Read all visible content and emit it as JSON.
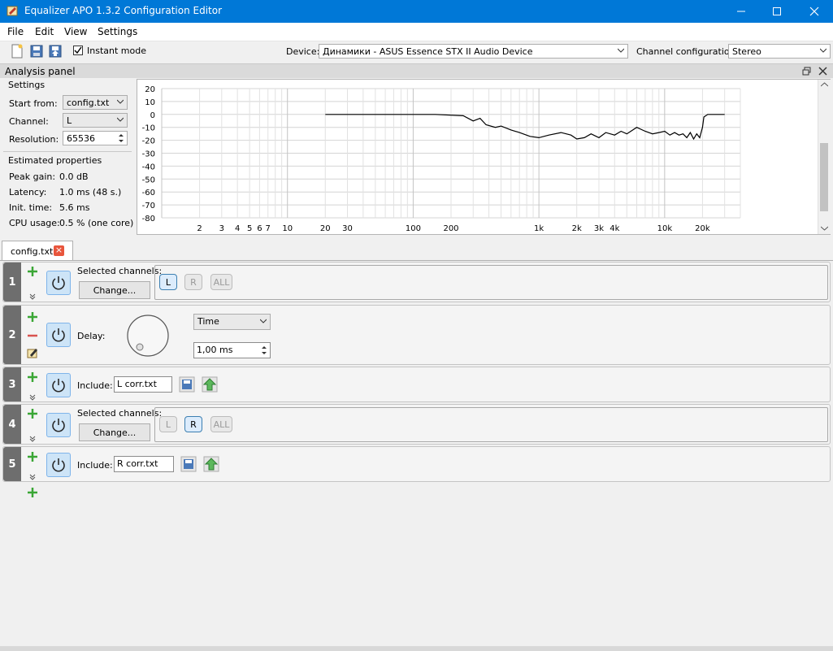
{
  "window": {
    "title": "Equalizer APO 1.3.2 Configuration Editor"
  },
  "menu": [
    "File",
    "Edit",
    "View",
    "Settings"
  ],
  "toolbar": {
    "instant_mode_label": "Instant mode",
    "instant_mode_checked": true,
    "device_label": "Device:",
    "device_value": "Динамики - ASUS Essence STX II Audio Device",
    "channel_config_label": "Channel configuration:",
    "channel_config_value": "Stereo"
  },
  "analysis_panel": {
    "title": "Analysis panel",
    "settings_header": "Settings",
    "start_from_label": "Start from:",
    "start_from_value": "config.txt",
    "channel_label": "Channel:",
    "channel_value": "L",
    "resolution_label": "Resolution:",
    "resolution_value": "65536",
    "estimated_header": "Estimated properties",
    "peak_gain_label": "Peak gain:",
    "peak_gain_value": "0.0 dB",
    "latency_label": "Latency:",
    "latency_value": "1.0 ms (48 s.)",
    "init_time_label": "Init. time:",
    "init_time_value": "5.6 ms",
    "cpu_usage_label": "CPU usage:",
    "cpu_usage_value": "0.5 % (one core)",
    "y_ticks": [
      "20",
      "10",
      "0",
      "-10",
      "-20",
      "-30",
      "-40",
      "-50",
      "-60",
      "-70",
      "-80"
    ],
    "x_ticks": [
      "2",
      "3",
      "4",
      "5",
      "6",
      "7",
      "10",
      "20",
      "30",
      "100",
      "200",
      "1k",
      "2k",
      "3k",
      "4k",
      "10k",
      "20k"
    ]
  },
  "tabs": [
    {
      "label": "config.txt",
      "close": "×"
    }
  ],
  "filters": {
    "f1": {
      "num": "1",
      "selected_label": "Selected channels:",
      "change_label": "Change...",
      "ch_l": "L",
      "ch_r": "R",
      "ch_all": "ALL"
    },
    "f2": {
      "num": "2",
      "delay_label": "Delay:",
      "unit_value": "Time",
      "delay_value": "1,00 ms"
    },
    "f3": {
      "num": "3",
      "include_label": "Include:",
      "include_value": "L corr.txt"
    },
    "f4": {
      "num": "4",
      "selected_label": "Selected channels:",
      "change_label": "Change...",
      "ch_l": "L",
      "ch_r": "R",
      "ch_all": "ALL"
    },
    "f5": {
      "num": "5",
      "include_label": "Include:",
      "include_value": "R corr.txt"
    }
  },
  "colors": {
    "titlebar": "#0078d7",
    "accent_green": "#3aa635",
    "remove_red": "#d9534f"
  }
}
